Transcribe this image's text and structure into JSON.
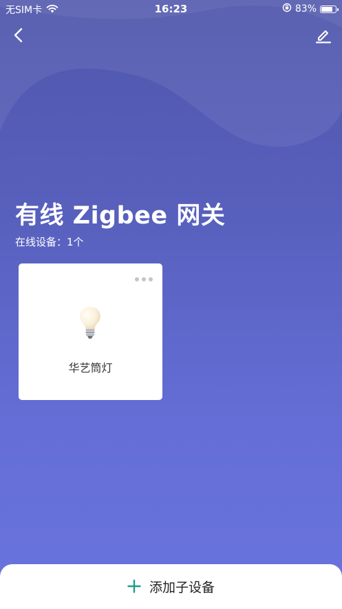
{
  "status_bar": {
    "carrier": "无SIM卡",
    "time": "16:23",
    "battery_percent_text": "83%",
    "battery_level": 0.83
  },
  "nav": {
    "back_icon": "chevron-left-icon",
    "edit_icon": "pencil-icon"
  },
  "gateway": {
    "title": "有线 Zigbee 网关",
    "online_label": "在线设备：1个"
  },
  "devices": [
    {
      "name": "华艺筒灯",
      "icon": "light-bulb-icon",
      "more_icon": "more-dots-icon"
    }
  ],
  "bottom": {
    "add_label": "添加子设备",
    "add_icon": "plus-icon",
    "accent": "#1a9f8a"
  },
  "colors": {
    "background_top": "#4f56ab",
    "background_bottom": "#6a74de",
    "card": "#ffffff"
  }
}
